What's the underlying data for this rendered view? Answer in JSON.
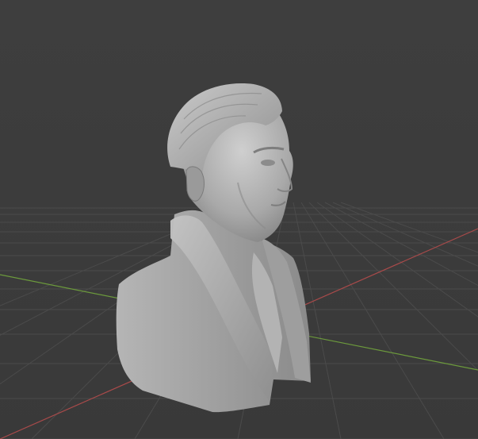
{
  "viewport": {
    "mode": "solid-shading",
    "background_color": "#3d3d3d",
    "grid_color": "#4a4a4a",
    "x_axis_color": "#a84a4a",
    "y_axis_color": "#6c9a3c",
    "object": {
      "name": "bust-sculpture",
      "shading_color": "#a9a9a9"
    }
  }
}
